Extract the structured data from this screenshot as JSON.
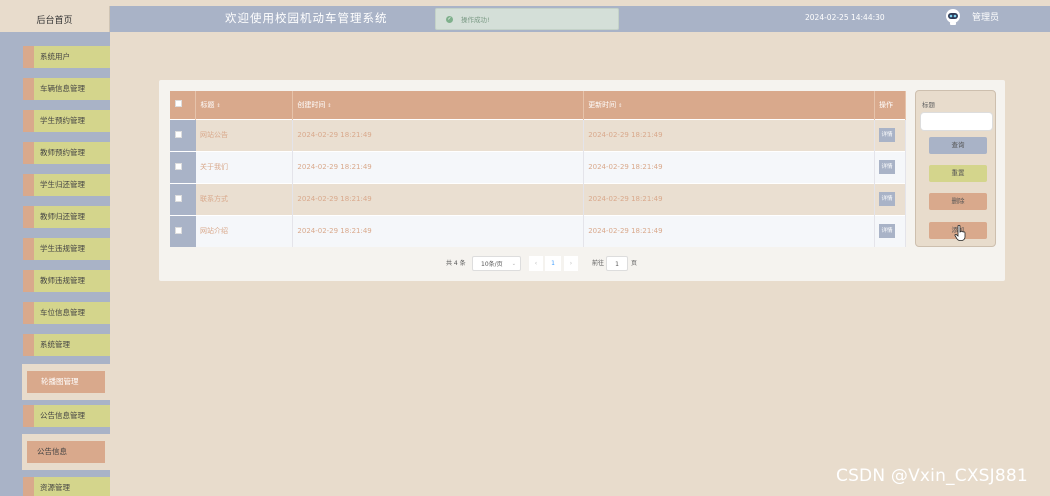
{
  "header": {
    "home_tab": "后台首页",
    "title": "欢迎使用校园机动车管理系统",
    "toast": "操作成功!",
    "datetime": "2024-02-25 14:44:30",
    "user": "管理员"
  },
  "sidebar": {
    "items": [
      {
        "label": "系统用户"
      },
      {
        "label": "车辆信息管理"
      },
      {
        "label": "学生预约管理"
      },
      {
        "label": "教师预约管理"
      },
      {
        "label": "学生归还管理"
      },
      {
        "label": "教师归还管理"
      },
      {
        "label": "学生违规管理"
      },
      {
        "label": "教师违规管理"
      },
      {
        "label": "车位信息管理"
      },
      {
        "label": "系统管理"
      },
      {
        "label": "轮播图管理"
      },
      {
        "label": "公告信息管理"
      },
      {
        "label": "公告信息"
      },
      {
        "label": "资源管理"
      }
    ]
  },
  "table": {
    "columns": [
      "标题",
      "创建时间",
      "更新时间",
      "操作"
    ],
    "rows": [
      {
        "title": "网站公告",
        "created": "2024-02-29 18:21:49",
        "updated": "2024-02-29 18:21:49",
        "action": "详情"
      },
      {
        "title": "关于我们",
        "created": "2024-02-29 18:21:49",
        "updated": "2024-02-29 18:21:49",
        "action": "详情"
      },
      {
        "title": "联系方式",
        "created": "2024-02-29 18:21:49",
        "updated": "2024-02-29 18:21:49",
        "action": "详情"
      },
      {
        "title": "网站介绍",
        "created": "2024-02-29 18:21:49",
        "updated": "2024-02-29 18:21:49",
        "action": "详情"
      }
    ]
  },
  "search": {
    "label": "标题",
    "query_btn": "查询",
    "reset_btn": "重置",
    "delete_btn": "删除",
    "add_btn": "添加"
  },
  "pagination": {
    "total": "共 4 条",
    "page_size": "10条/页",
    "prev": "‹",
    "current_page": "1",
    "next": "›",
    "goto_label": "前往",
    "goto_value": "1",
    "unit": "页"
  },
  "watermark": "CSDN @Vxin_CXSJ881",
  "colors": {
    "background": "#e8dccc",
    "bar": "#a9b3c7",
    "accent": "#d9a98c",
    "menu": "#d4d58c"
  }
}
